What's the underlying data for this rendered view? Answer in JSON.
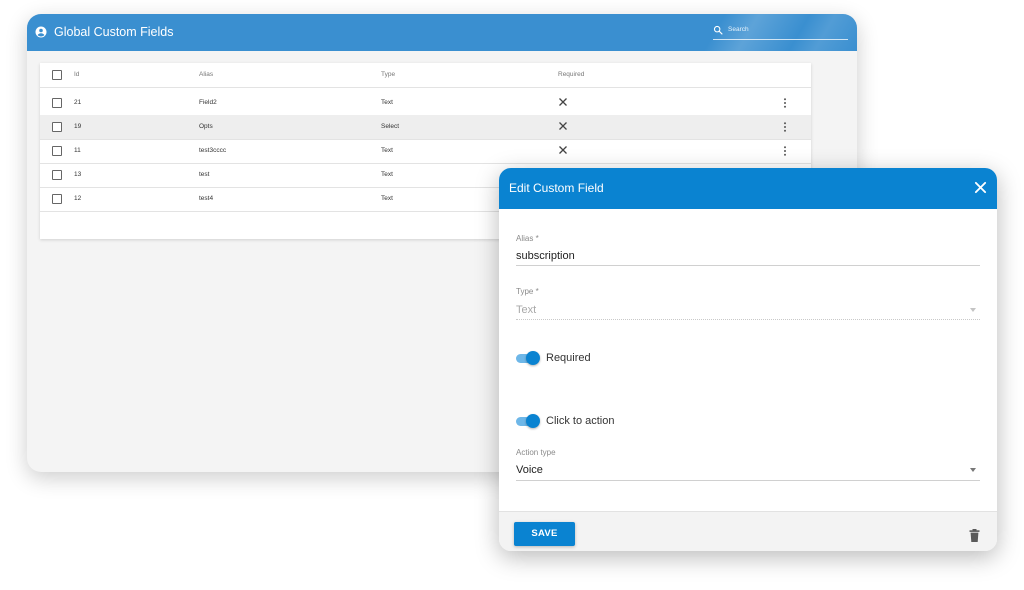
{
  "window": {
    "title": "Global Custom Fields",
    "search_placeholder": "Search",
    "header_color": "#3a8fd0"
  },
  "table": {
    "columns": [
      "Id",
      "Alias",
      "Type",
      "Required"
    ],
    "rows": [
      {
        "id": "21",
        "alias": "Field2",
        "type": "Text",
        "required": false,
        "has_menu": true
      },
      {
        "id": "19",
        "alias": "Opts",
        "type": "Select",
        "required": false,
        "has_menu": true
      },
      {
        "id": "11",
        "alias": "test3cccc",
        "type": "Text",
        "required": false,
        "has_menu": true
      },
      {
        "id": "13",
        "alias": "test",
        "type": "Text",
        "required": null,
        "has_menu": false
      },
      {
        "id": "12",
        "alias": "test4",
        "type": "Text",
        "required": null,
        "has_menu": false
      }
    ]
  },
  "dialog": {
    "title": "Edit Custom Field",
    "header_color": "#0a83d1",
    "alias_label": "Alias *",
    "alias_value": "subscription",
    "type_label": "Type *",
    "type_value": "Text",
    "required_label": "Required",
    "required_on": true,
    "click_to_action_label": "Click to action",
    "click_to_action_on": true,
    "action_type_label": "Action type",
    "action_type_value": "Voice",
    "save_label": "SAVE"
  },
  "icons": {
    "account": "account-circle-icon",
    "search": "search-icon",
    "close": "close-icon",
    "x_mark": "close-icon",
    "kebab": "more-vert-icon",
    "dropdown": "arrow-drop-down-icon",
    "delete": "trash-icon"
  }
}
